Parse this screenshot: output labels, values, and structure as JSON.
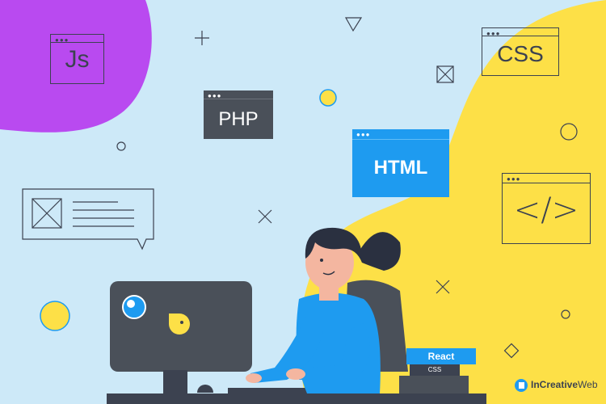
{
  "windows": {
    "js": {
      "label": "Js"
    },
    "php": {
      "label": "PHP"
    },
    "html": {
      "label": "HTML"
    },
    "css": {
      "label": "CSS"
    },
    "code": {
      "label": "</>"
    }
  },
  "books": {
    "top": "React",
    "middle": "CSS"
  },
  "brand": {
    "name_part1": "InCreative",
    "name_part2": "Web"
  },
  "colors": {
    "background": "#cde9f8",
    "purple": "#b94af0",
    "yellow": "#fde047",
    "blue": "#1e9bf0",
    "dark_window": "#4a5059"
  }
}
